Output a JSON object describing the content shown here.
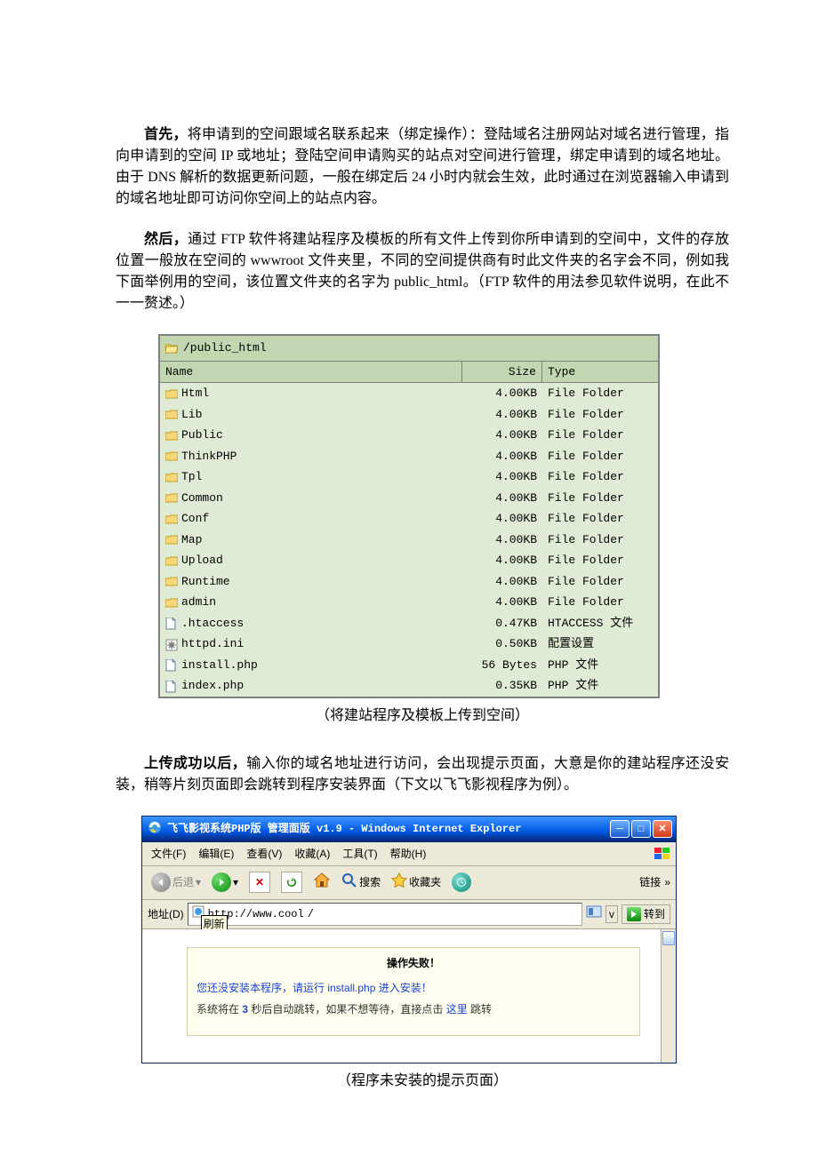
{
  "para1": {
    "lead": "首先，",
    "body": "将申请到的空间跟域名联系起来（绑定操作）：登陆域名注册网站对域名进行管理，指向申请到的空间 IP 或地址；登陆空间申请购买的站点对空间进行管理，绑定申请到的域名地址。由于 DNS 解析的数据更新问题，一般在绑定后 24 小时内就会生效，此时通过在浏览器输入申请到的域名地址即可访问你空间上的站点内容。"
  },
  "para2": {
    "lead": "然后，",
    "body": "通过 FTP 软件将建站程序及模板的所有文件上传到你所申请到的空间中，文件的存放位置一般放在空间的 wwwroot 文件夹里，不同的空间提供商有时此文件夹的名字会不同，例如我下面举例用的空间，该位置文件夹的名字为 public_html。（FTP 软件的用法参见软件说明，在此不一一赘述。）"
  },
  "ftp": {
    "path": "/public_html",
    "columns": {
      "name": "Name",
      "size": "Size",
      "type": "Type"
    },
    "rows": [
      {
        "icon": "folder",
        "name": "Html",
        "size": "4.00KB",
        "type": "File Folder"
      },
      {
        "icon": "folder",
        "name": "Lib",
        "size": "4.00KB",
        "type": "File Folder"
      },
      {
        "icon": "folder",
        "name": "Public",
        "size": "4.00KB",
        "type": "File Folder"
      },
      {
        "icon": "folder",
        "name": "ThinkPHP",
        "size": "4.00KB",
        "type": "File Folder"
      },
      {
        "icon": "folder",
        "name": "Tpl",
        "size": "4.00KB",
        "type": "File Folder"
      },
      {
        "icon": "folder",
        "name": "Common",
        "size": "4.00KB",
        "type": "File Folder"
      },
      {
        "icon": "folder",
        "name": "Conf",
        "size": "4.00KB",
        "type": "File Folder"
      },
      {
        "icon": "folder",
        "name": "Map",
        "size": "4.00KB",
        "type": "File Folder"
      },
      {
        "icon": "folder",
        "name": "Upload",
        "size": "4.00KB",
        "type": "File Folder"
      },
      {
        "icon": "folder",
        "name": "Runtime",
        "size": "4.00KB",
        "type": "File Folder"
      },
      {
        "icon": "folder",
        "name": "admin",
        "size": "4.00KB",
        "type": "File Folder"
      },
      {
        "icon": "file",
        "name": ".htaccess",
        "size": "0.47KB",
        "type": "HTACCESS 文件"
      },
      {
        "icon": "ini",
        "name": "httpd.ini",
        "size": "0.50KB",
        "type": "配置设置"
      },
      {
        "icon": "file",
        "name": "install.php",
        "size": "56 Bytes",
        "type": "PHP 文件"
      },
      {
        "icon": "file",
        "name": "index.php",
        "size": "0.35KB",
        "type": "PHP 文件"
      }
    ]
  },
  "caption1": "（将建站程序及模板上传到空间）",
  "para3": {
    "lead": "上传成功以后，",
    "body": "输入你的域名地址进行访问，会出现提示页面，大意是你的建站程序还没安装，稍等片刻页面即会跳转到程序安装界面（下文以飞飞影视程序为例）。"
  },
  "ie": {
    "title": "飞飞影视系统PHP版 管理面版 v1.9 - Windows Internet Explorer",
    "menu": {
      "file": "文件(F)",
      "edit": "编辑(E)",
      "view": "查看(V)",
      "fav": "收藏(A)",
      "tools": "工具(T)",
      "help": "帮助(H)"
    },
    "toolbar": {
      "back": "后退",
      "search": "搜索",
      "favorites": "收藏夹",
      "links": "链接"
    },
    "addr": {
      "label": "地址(D)",
      "url": "http://www.cool",
      "tooltip": "刷新",
      "go": "转到"
    },
    "msg": {
      "header": "操作失败！",
      "line1a": "您还没安装本程序，请运行 ",
      "line1b": "install.php",
      "line1c": " 进入安装！",
      "line2a": "系统将在 ",
      "line2b": "3",
      "line2c": " 秒后自动跳转，如果不想等待，直接点击 ",
      "line2d": "这里",
      "line2e": " 跳转"
    }
  },
  "caption2": "（程序未安装的提示页面）"
}
